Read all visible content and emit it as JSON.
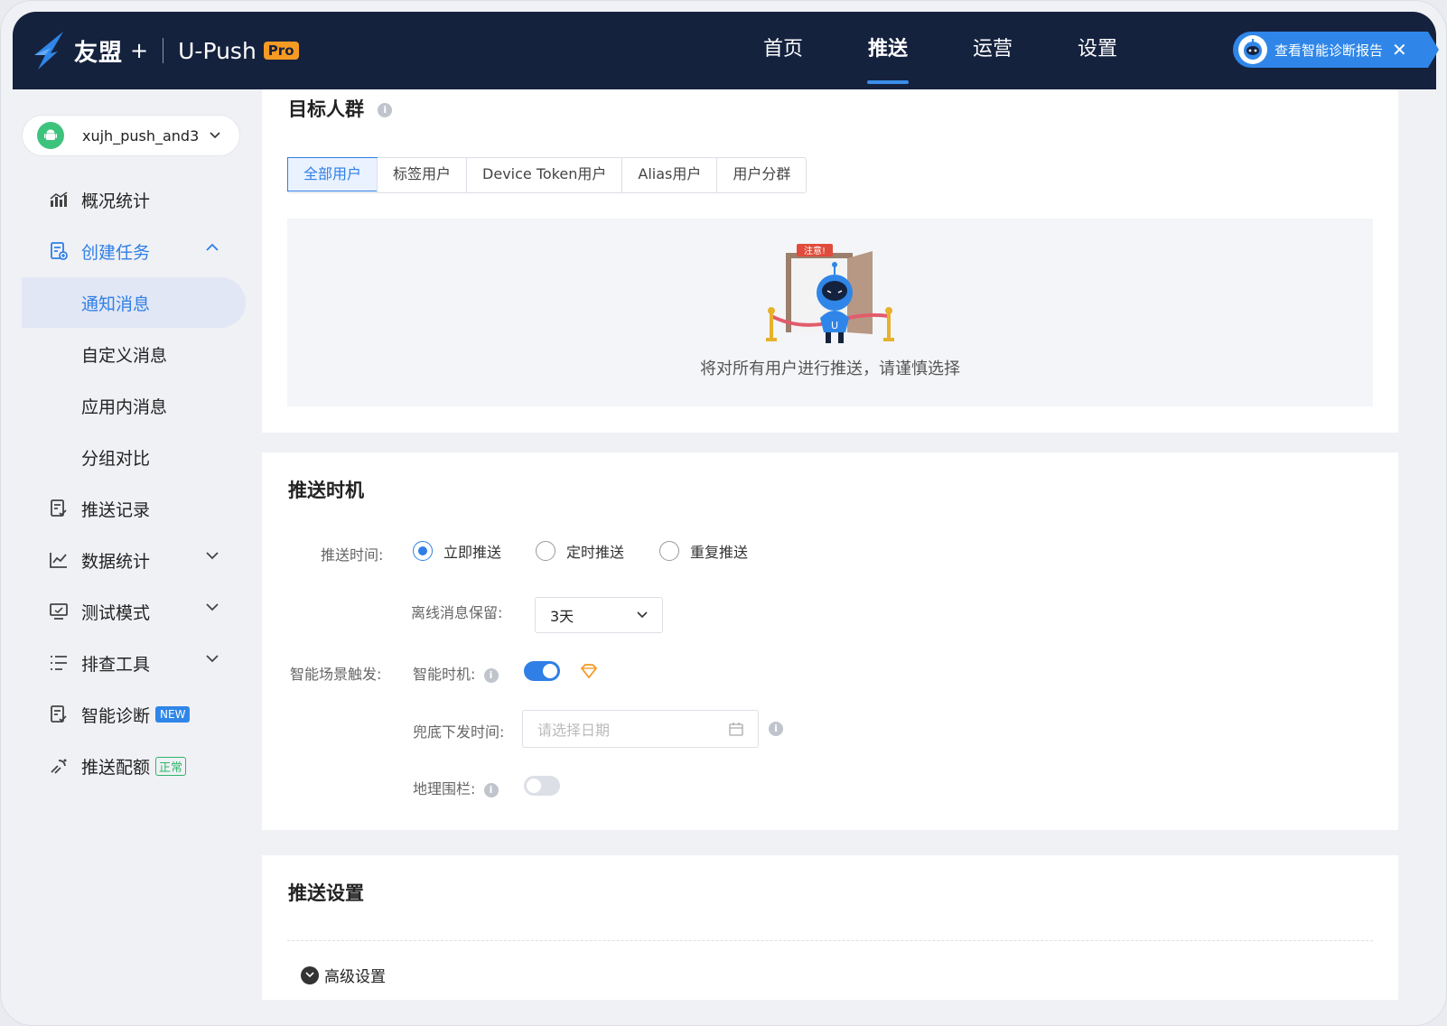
{
  "brand": {
    "name": "友盟",
    "plus": "+",
    "product": "U-Push",
    "badge": "Pro"
  },
  "topnav": [
    {
      "label": "首页",
      "active": false
    },
    {
      "label": "推送",
      "active": true
    },
    {
      "label": "运营",
      "active": false
    },
    {
      "label": "设置",
      "active": false
    }
  ],
  "diagnosis_pill": {
    "label": "查看智能诊断报告",
    "close": "✕"
  },
  "sidebar": {
    "app_name": "xujh_push_and3",
    "items": [
      {
        "label": "概况统计",
        "icon": "chart-icon"
      },
      {
        "label": "创建任务",
        "icon": "create-task-icon"
      },
      {
        "label": "通知消息"
      },
      {
        "label": "自定义消息"
      },
      {
        "label": "应用内消息"
      },
      {
        "label": "分组对比"
      },
      {
        "label": "推送记录",
        "icon": "record-icon"
      },
      {
        "label": "数据统计",
        "icon": "line-chart-icon"
      },
      {
        "label": "测试模式",
        "icon": "monitor-icon"
      },
      {
        "label": "排查工具",
        "icon": "list-icon"
      },
      {
        "label": "智能诊断",
        "icon": "diagnosis-icon",
        "badge": "NEW"
      },
      {
        "label": "推送配额",
        "icon": "quota-icon",
        "badge": "正常"
      }
    ]
  },
  "target": {
    "title": "目标人群",
    "tabs": [
      "全部用户",
      "标签用户",
      "Device Token用户",
      "Alias用户",
      "用户分群"
    ],
    "active_tab": 0,
    "notice_tag": "注意!",
    "warning": "将对所有用户进行推送，请谨慎选择"
  },
  "timing": {
    "title": "推送时机",
    "push_time_label": "推送时间:",
    "options": [
      "立即推送",
      "定时推送",
      "重复推送"
    ],
    "selected": 0,
    "offline_label": "离线消息保留:",
    "offline_value": "3天",
    "smart_scene_label": "智能场景触发:",
    "smart_timing_label": "智能时机:",
    "smart_timing_on": true,
    "fallback_label": "兜底下发时间:",
    "fallback_placeholder": "请选择日期",
    "geofence_label": "地理围栏:",
    "geofence_on": false
  },
  "settings": {
    "title": "推送设置",
    "advanced_label": "高级设置"
  },
  "colors": {
    "accent": "#2f7fe6",
    "topbar": "#15223e",
    "pro": "#f59a23"
  }
}
